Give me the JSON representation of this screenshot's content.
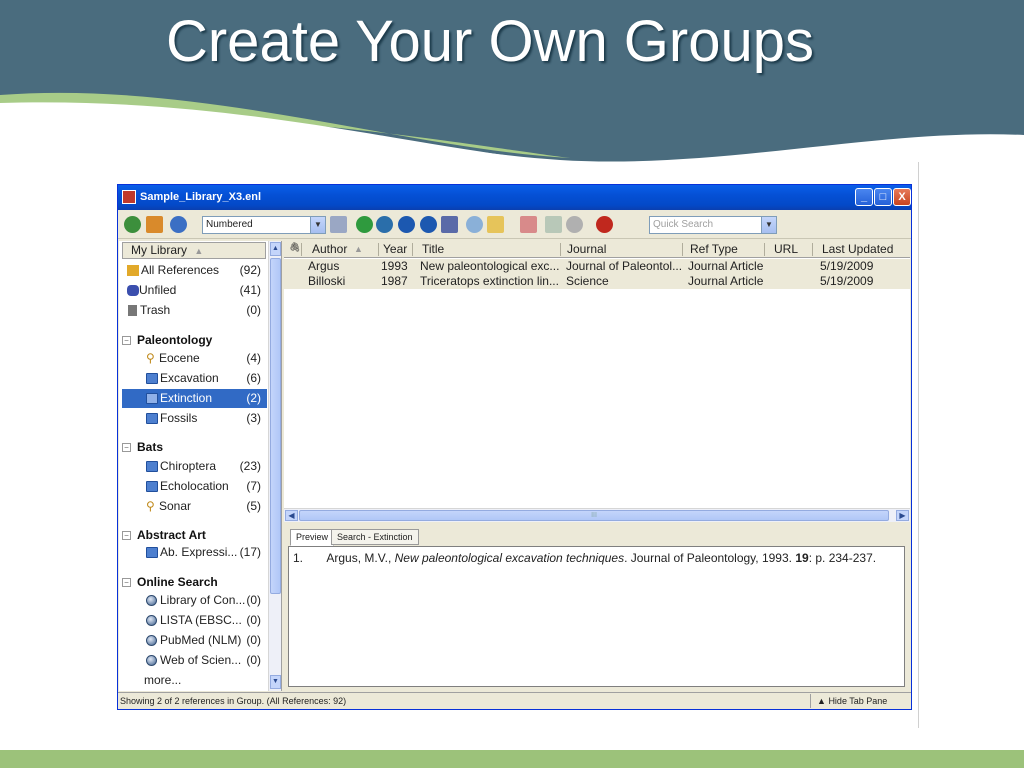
{
  "slide": {
    "title": "Create Your Own Groups"
  },
  "window": {
    "title": "Sample_Library_X3.enl",
    "buttons": {
      "minimize": "_",
      "maximize": "□",
      "close": "X"
    }
  },
  "toolbar": {
    "style_select": "Numbered",
    "quick_search_placeholder": "Quick Search"
  },
  "sidebar": {
    "header": "My Library",
    "sort_indicator": "▲",
    "items": [
      {
        "label": "All References",
        "count": "(92)"
      },
      {
        "label": "Unfiled",
        "count": "(41)"
      },
      {
        "label": "Trash",
        "count": "(0)"
      }
    ],
    "groups": [
      {
        "name": "Paleontology",
        "toggle": "−",
        "items": [
          {
            "label": "Eocene",
            "count": "(4)",
            "icon": "smart-group-icon"
          },
          {
            "label": "Excavation",
            "count": "(6)",
            "icon": "folder-icon"
          },
          {
            "label": "Extinction",
            "count": "(2)",
            "icon": "folder-icon",
            "selected": true
          },
          {
            "label": "Fossils",
            "count": "(3)",
            "icon": "folder-icon"
          }
        ]
      },
      {
        "name": "Bats",
        "toggle": "−",
        "items": [
          {
            "label": "Chiroptera",
            "count": "(23)",
            "icon": "folder-icon"
          },
          {
            "label": "Echolocation",
            "count": "(7)",
            "icon": "folder-icon"
          },
          {
            "label": "Sonar",
            "count": "(5)",
            "icon": "smart-group-icon"
          }
        ]
      },
      {
        "name": "Abstract Art",
        "toggle": "−",
        "items": [
          {
            "label": "Ab. Expressi...",
            "count": "(17)",
            "icon": "folder-icon"
          }
        ]
      },
      {
        "name": "Online Search",
        "toggle": "−",
        "items": [
          {
            "label": "Library of Con...",
            "count": "(0)",
            "icon": "online-search-icon"
          },
          {
            "label": "LISTA (EBSC...",
            "count": "(0)",
            "icon": "online-search-icon"
          },
          {
            "label": "PubMed (NLM)",
            "count": "(0)",
            "icon": "online-search-icon"
          },
          {
            "label": "Web of Scien...",
            "count": "(0)",
            "icon": "online-search-icon"
          }
        ]
      }
    ],
    "more": "more..."
  },
  "reference_list": {
    "columns": {
      "attachment": "🖇",
      "author": "Author",
      "author_sort": "▲",
      "year": "Year",
      "title": "Title",
      "journal": "Journal",
      "ref_type": "Ref Type",
      "url": "URL",
      "last_updated": "Last Updated"
    },
    "rows": [
      {
        "author": "Argus",
        "year": "1993",
        "title": "New paleontological exc...",
        "journal": "Journal of Paleontol...",
        "ref_type": "Journal Article",
        "url": "",
        "last_updated": "5/19/2009"
      },
      {
        "author": "Billoski",
        "year": "1987",
        "title": "Triceratops extinction lin...",
        "journal": "Science",
        "ref_type": "Journal Article",
        "url": "",
        "last_updated": "5/19/2009"
      }
    ],
    "hscroll_grip": "III"
  },
  "preview": {
    "tabs": [
      "Preview",
      "Search - Extinction"
    ],
    "citation": {
      "number": "1.",
      "authors": "Argus, M.V., ",
      "title": "New paleontological excavation techniques",
      "journal_year": ". Journal of Paleontology, 1993. ",
      "volume": "19",
      "pages": ": p. 234-237."
    }
  },
  "status": {
    "text": "Showing 2 of 2 references in Group. (All References: 92)",
    "hide_tab_pane": "Hide Tab Pane"
  },
  "colors": {
    "banner": "#4a6c7e",
    "banner_stripe": "#a8cc88",
    "footer": "#9cc27a",
    "selection": "#316ac5"
  }
}
